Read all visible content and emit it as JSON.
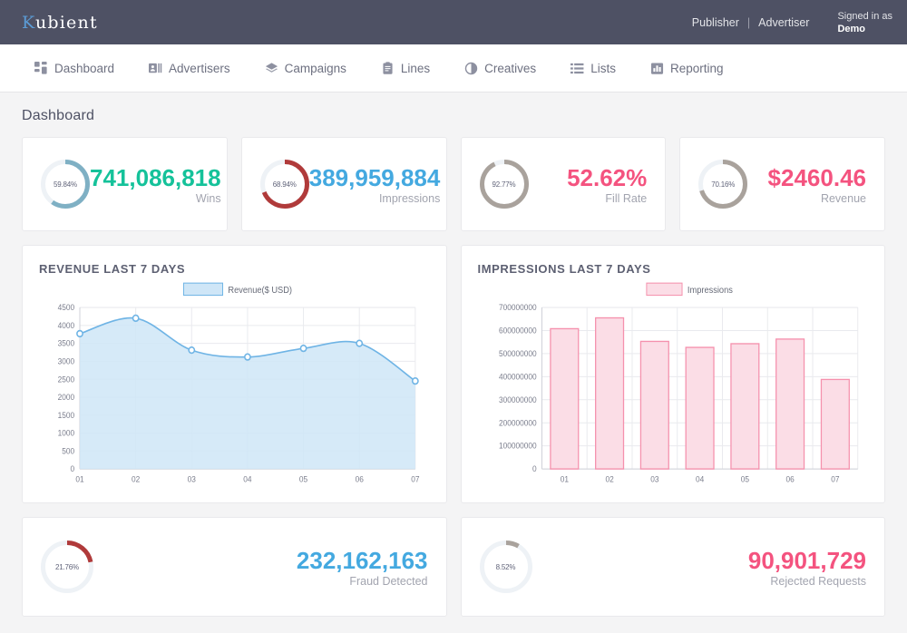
{
  "header": {
    "logo_k": "K",
    "logo_rest": "ubient",
    "publisher_label": "Publisher",
    "separator": "|",
    "advertiser_label": "Advertiser",
    "signed_in_as": "Signed in as",
    "user_name": "Demo"
  },
  "nav": {
    "items": [
      {
        "label": "Dashboard",
        "icon": "grid-icon"
      },
      {
        "label": "Advertisers",
        "icon": "id-card-icon"
      },
      {
        "label": "Campaigns",
        "icon": "layers-icon"
      },
      {
        "label": "Lines",
        "icon": "clipboard-icon"
      },
      {
        "label": "Creatives",
        "icon": "contrast-circle-icon"
      },
      {
        "label": "Lists",
        "icon": "list-icon"
      },
      {
        "label": "Reporting",
        "icon": "bar-chart-icon"
      }
    ]
  },
  "page": {
    "title": "Dashboard"
  },
  "kpis": [
    {
      "percent": "59.84%",
      "percent_value": 59.84,
      "value": "741,086,818",
      "label": "Wins",
      "value_color": "#15c29a",
      "arc_color": "#7fb0c4",
      "track_color": "#eef2f6"
    },
    {
      "percent": "68.94%",
      "percent_value": 68.94,
      "value": "389,959,884",
      "label": "Impressions",
      "value_color": "#44a9e0",
      "arc_color": "#b03a3a",
      "track_color": "#eef2f6"
    },
    {
      "percent": "92.77%",
      "percent_value": 92.77,
      "value": "52.62%",
      "label": "Fill Rate",
      "value_color": "#f4537f",
      "arc_color": "#a9a29c",
      "track_color": "#eef2f6"
    },
    {
      "percent": "70.16%",
      "percent_value": 70.16,
      "value": "$2460.46",
      "label": "Revenue",
      "value_color": "#f4537f",
      "arc_color": "#a9a29c",
      "track_color": "#eef2f6"
    }
  ],
  "kpis_bottom": [
    {
      "percent": "21.76%",
      "percent_value": 21.76,
      "value": "232,162,163",
      "label": "Fraud Detected",
      "value_color": "#44a9e0",
      "arc_color": "#b03a3a",
      "track_color": "#eef2f6"
    },
    {
      "percent": "8.52%",
      "percent_value": 8.52,
      "value": "90,901,729",
      "label": "Rejected Requests",
      "value_color": "#f4537f",
      "arc_color": "#a9a29c",
      "track_color": "#eef2f6"
    }
  ],
  "charts": {
    "revenue_title": "REVENUE LAST 7 DAYS",
    "impressions_title": "IMPRESSIONS LAST 7 DAYS"
  },
  "chart_data": [
    {
      "type": "area",
      "title": "REVENUE LAST 7 DAYS",
      "legend": [
        "Revenue($ USD)"
      ],
      "legend_position": "top-center",
      "categories": [
        "01",
        "02",
        "03",
        "04",
        "05",
        "06",
        "07"
      ],
      "values": [
        3770,
        4200,
        3310,
        3120,
        3360,
        3500,
        2450
      ],
      "xlabel": "",
      "ylabel": "",
      "ylim": [
        0,
        4500
      ],
      "yticks": [
        0,
        500,
        1000,
        1500,
        2000,
        2500,
        3000,
        3500,
        4000,
        4500
      ],
      "grid": true,
      "line_color": "#6fb4e5",
      "fill_color": "#cfe6f7"
    },
    {
      "type": "bar",
      "title": "IMPRESSIONS LAST 7 DAYS",
      "legend": [
        "Impressions"
      ],
      "legend_position": "top-center",
      "categories": [
        "01",
        "02",
        "03",
        "04",
        "05",
        "06",
        "07"
      ],
      "values": [
        608000000,
        655000000,
        553000000,
        527000000,
        543000000,
        563000000,
        388000000
      ],
      "xlabel": "",
      "ylabel": "",
      "ylim": [
        0,
        700000000
      ],
      "yticks": [
        0,
        100000000,
        200000000,
        300000000,
        400000000,
        500000000,
        600000000,
        700000000
      ],
      "ytick_labels": [
        "0",
        "100000000",
        "200000000",
        "300000000",
        "400000000",
        "500000000",
        "600000000",
        "700000000"
      ],
      "grid": true,
      "bar_fill": "#fbdde6",
      "bar_stroke": "#f591ad"
    }
  ]
}
